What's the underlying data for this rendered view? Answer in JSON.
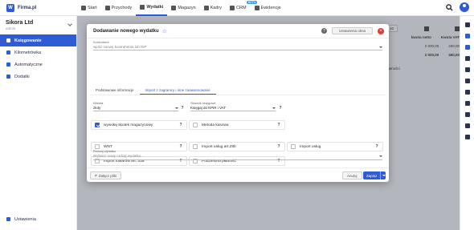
{
  "app": {
    "logo_letter": "W",
    "logo_text": "Firma.pl"
  },
  "nav": {
    "items": [
      {
        "label": "Start",
        "active": false
      },
      {
        "label": "Przychody",
        "active": false
      },
      {
        "label": "Wydatki",
        "active": true
      },
      {
        "label": "Magazyn",
        "active": false
      },
      {
        "label": "Kadry",
        "active": false
      },
      {
        "label": "CRM",
        "active": false,
        "badge": "BETA"
      },
      {
        "label": "Ewidencje",
        "active": false
      }
    ]
  },
  "sidebar": {
    "company_name": "Sikora Ltd",
    "company_sub": "admin",
    "items": [
      {
        "label": "Księgowanie",
        "active": true
      },
      {
        "label": "Kilometrówka",
        "active": false
      },
      {
        "label": "Automatyczne",
        "active": false
      },
      {
        "label": "Dodatki",
        "active": false
      }
    ],
    "settings_label": "Ustawienia"
  },
  "background": {
    "page_size": "10",
    "col_netto": "kwota netto",
    "col_vat": "Kwota VAT",
    "row1_netto": "2 000,00",
    "row1_vat": "460,00",
    "row2_netto": "2 000,00",
    "row2_vat": "460,00",
    "filter_label": "płatności"
  },
  "modal": {
    "title": "Dodawanie nowego wydatku",
    "settings_button": "Ustawienia okna",
    "contractor": {
      "label": "Kontrahent",
      "placeholder": "wpisz nazwę kontrahenta lub NIP"
    },
    "tabs": [
      {
        "label": "Podstawowe informacje",
        "active": false
      },
      {
        "label": "Import z zagranicy i inne zaawansowane",
        "active": true
      }
    ],
    "currency": {
      "label": "Waluta",
      "value": "złoty"
    },
    "ledger": {
      "label": "Słownik księgowe",
      "value": "Księgaj do KPiR i VAT"
    },
    "checkboxes": [
      {
        "label": "wywołaj skutek magazynowy",
        "checked": true
      },
      {
        "label": "Metoda kasowa",
        "checked": false
      },
      {
        "label": "WNT",
        "checked": false
      },
      {
        "label": "Import usług art.28b",
        "checked": false
      },
      {
        "label": "Import usług",
        "checked": false
      },
      {
        "label": "Import towarów art. 33a",
        "checked": false
      },
      {
        "label": "Podzielona płatność",
        "checked": false
      }
    ],
    "expense_type": {
      "label": "Rodzaj wydatku",
      "placeholder": "Wybierz nowy rodzaj wydatku..."
    },
    "attach_button": "Załącz pliki",
    "cancel_button": "Anuluj",
    "save_button": "Zapisz"
  }
}
